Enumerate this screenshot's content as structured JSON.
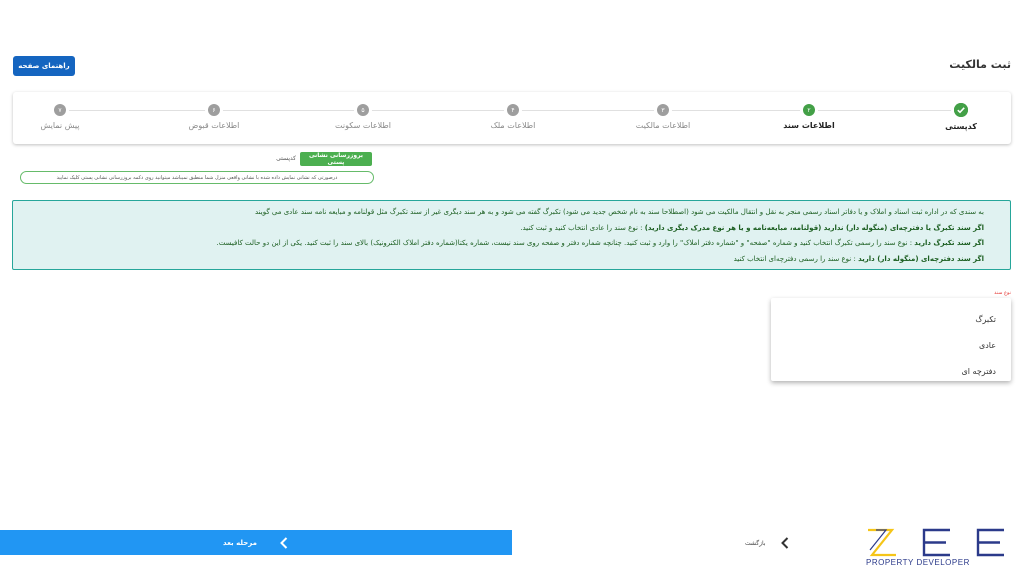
{
  "header": {
    "title": "ثبت مالکیت",
    "help_label": "راهنمای صفحه"
  },
  "stepper": {
    "steps": [
      {
        "label": "کدپستی",
        "marker": "",
        "state": "done"
      },
      {
        "label": "اطلاعات سند",
        "marker": "۲",
        "state": "active"
      },
      {
        "label": "اطلاعات مالکیت",
        "marker": "۳",
        "state": "pending"
      },
      {
        "label": "اطلاعات ملک",
        "marker": "۴",
        "state": "pending"
      },
      {
        "label": "اطلاعات سکونت",
        "marker": "۵",
        "state": "pending"
      },
      {
        "label": "اطلاعات قبوض",
        "marker": "۶",
        "state": "pending"
      },
      {
        "label": "پیش نمایش",
        "marker": "۷",
        "state": "pending"
      }
    ]
  },
  "postal": {
    "button_label": "بروزرسانی نشانی پستی",
    "code_label": "کدپستی",
    "hint": "درصورتی که نشانی نمایش داده شده با نشانی واقعی منزل شما منطبق نمیباشد میتوانید روی دکمه بروزرسانی نشانی پستی کلیک نمایید"
  },
  "info": {
    "items": [
      {
        "bold": "",
        "text": "به سندی که در اداره ثبت اسناد و املاک و یا دفاتر اسناد رسمی منجر به نقل و انتقال مالکیت می شود (اصطلاحا سند به نام شخص جدید می شود) تکبرگ گفته می شود و به هر سند دیگری غیر از سند تکبرگ مثل قولنامه و مبایعه نامه سند عادی می گویند"
      },
      {
        "bold": "اگر سند تکبرگ یا دفترچه‌ای (منگوله دار) ندارید (قولنامه، مبایعه‌نامه و یا هر نوع مدرک دیگری دارید)",
        "text": " : نوع سند را عادی انتخاب کنید و ثبت کنید."
      },
      {
        "bold": "اگر سند تکبرگ دارید",
        "text": " : نوع سند را رسمی تکبرگ انتخاب کنید و شماره \"صفحه\" و \"شماره دفتر املاک\" را وارد و ثبت کنید. چنانچه شماره دفتر و صفحه روی سند نیست، شماره یکتا(شماره دفتر املاک الکترونیک) بالای سند را ثبت کنید. یکی از این دو حالت کافیست."
      },
      {
        "bold": "اگر سند دفترچه‌ای (منگوله دار) دارید",
        "text": " : نوع سند را رسمی دفترچه‌ای انتخاب کنید"
      }
    ]
  },
  "doc_type": {
    "label": "نوع سند",
    "options": [
      "تکبرگ",
      "عادی",
      "دفترچه ای"
    ]
  },
  "footer": {
    "next_label": "مرحله بعد",
    "back_label": "بازگشت"
  },
  "logo": {
    "mark": "ZEE",
    "subtitle": "PROPERTY DEVELOPER",
    "color": "#2b3a8a",
    "accent": "#f5c518"
  }
}
